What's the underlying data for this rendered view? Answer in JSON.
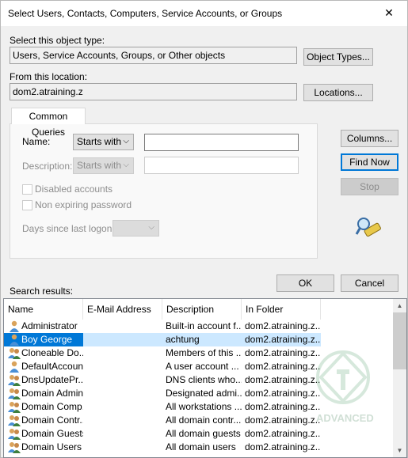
{
  "window": {
    "title": "Select Users, Contacts, Computers, Service Accounts, or Groups",
    "close_glyph": "✕"
  },
  "object_type": {
    "label": "Select this object type:",
    "value": "Users, Service Accounts, Groups, or Other objects",
    "button": "Object Types..."
  },
  "location": {
    "label": "From this location:",
    "value": "dom2.atraining.z",
    "button": "Locations..."
  },
  "queries": {
    "tab_label": "Common Queries",
    "name_label": "Name:",
    "name_mode": "Starts with",
    "name_value": "",
    "description_label": "Description:",
    "description_mode": "Starts with",
    "description_value": "",
    "disabled_accounts": "Disabled accounts",
    "non_expiring": "Non expiring password",
    "days_label": "Days since last logon:",
    "days_value": ""
  },
  "side_buttons": {
    "columns": "Columns...",
    "find_now": "Find Now",
    "stop": "Stop"
  },
  "dialog_buttons": {
    "ok": "OK",
    "cancel": "Cancel"
  },
  "results": {
    "label": "Search results:",
    "columns": [
      "Name",
      "E-Mail Address",
      "Description",
      "In Folder"
    ],
    "rows": [
      {
        "name": "Administrator",
        "email": "",
        "description": "Built-in account f...",
        "folder": "dom2.atraining.z...",
        "icon": "user-icon"
      },
      {
        "name": "Boy George",
        "email": "",
        "description": "achtung",
        "folder": "dom2.atraining.z...",
        "icon": "user-icon"
      },
      {
        "name": "Cloneable Do...",
        "email": "",
        "description": "Members of this ...",
        "folder": "dom2.atraining.z...",
        "icon": "group-icon"
      },
      {
        "name": "DefaultAccount",
        "email": "",
        "description": "A user account ...",
        "folder": "dom2.atraining.z...",
        "icon": "user-icon"
      },
      {
        "name": "DnsUpdatePr...",
        "email": "",
        "description": "DNS clients who...",
        "folder": "dom2.atraining.z...",
        "icon": "group-icon"
      },
      {
        "name": "Domain Admins",
        "email": "",
        "description": "Designated admi...",
        "folder": "dom2.atraining.z...",
        "icon": "group-icon"
      },
      {
        "name": "Domain Comp...",
        "email": "",
        "description": "All workstations ...",
        "folder": "dom2.atraining.z...",
        "icon": "group-icon"
      },
      {
        "name": "Domain Contr...",
        "email": "",
        "description": "All domain contr...",
        "folder": "dom2.atraining.z...",
        "icon": "group-icon"
      },
      {
        "name": "Domain Guests",
        "email": "",
        "description": "All domain guests",
        "folder": "dom2.atraining.z...",
        "icon": "group-icon"
      },
      {
        "name": "Domain Users",
        "email": "",
        "description": "All domain users",
        "folder": "dom2.atraining.z...",
        "icon": "group-icon"
      }
    ],
    "selected_index": 1
  },
  "watermark": {
    "text": "ADVANCED"
  }
}
